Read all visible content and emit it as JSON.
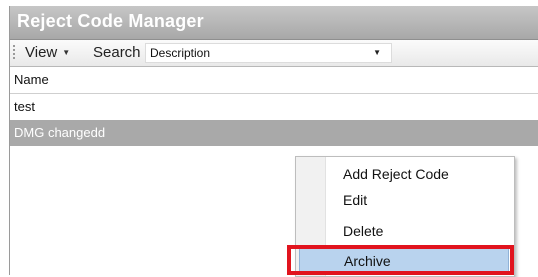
{
  "window": {
    "title": "Reject Code Manager"
  },
  "toolbar": {
    "view_label": "View",
    "search_label": "Search",
    "search_field": {
      "selected": "Description"
    }
  },
  "grid": {
    "column_header": "Name",
    "rows": [
      {
        "name": "test",
        "selected": false
      },
      {
        "name": "DMG changedd",
        "selected": true
      }
    ]
  },
  "context_menu": {
    "items": [
      {
        "label": "Add Reject Code"
      },
      {
        "label": "Edit"
      },
      {
        "label": "Delete"
      },
      {
        "label": "Archive",
        "hovered": true
      }
    ]
  },
  "colors": {
    "title_bar": "#a8a8a8",
    "selected_row": "#a9a9a9",
    "menu_hover": "#b9d3ee",
    "annotation_box": "#e1141e"
  }
}
